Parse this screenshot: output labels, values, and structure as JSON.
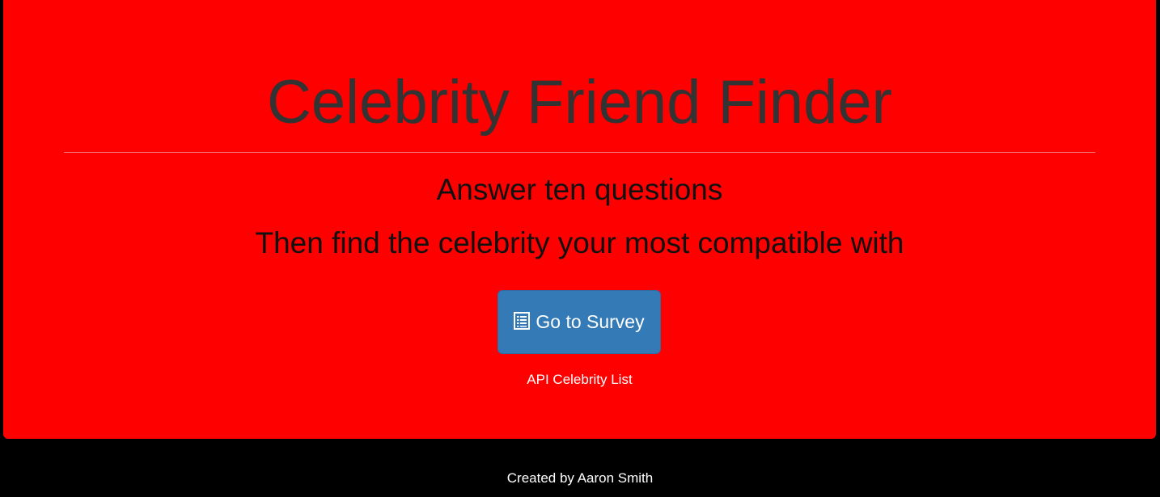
{
  "hero": {
    "title": "Celebrity Friend Finder",
    "subtitle_line1": "Answer ten questions",
    "subtitle_line2": "Then find the celebrity your most compatible with",
    "survey_button": {
      "icon": "list-alt-icon",
      "label": "Go to Survey"
    },
    "api_link_label": "API Celebrity List",
    "background_color": "#ff0000",
    "button_color": "#337ab7"
  },
  "footer": {
    "text": "Created by Aaron Smith"
  }
}
